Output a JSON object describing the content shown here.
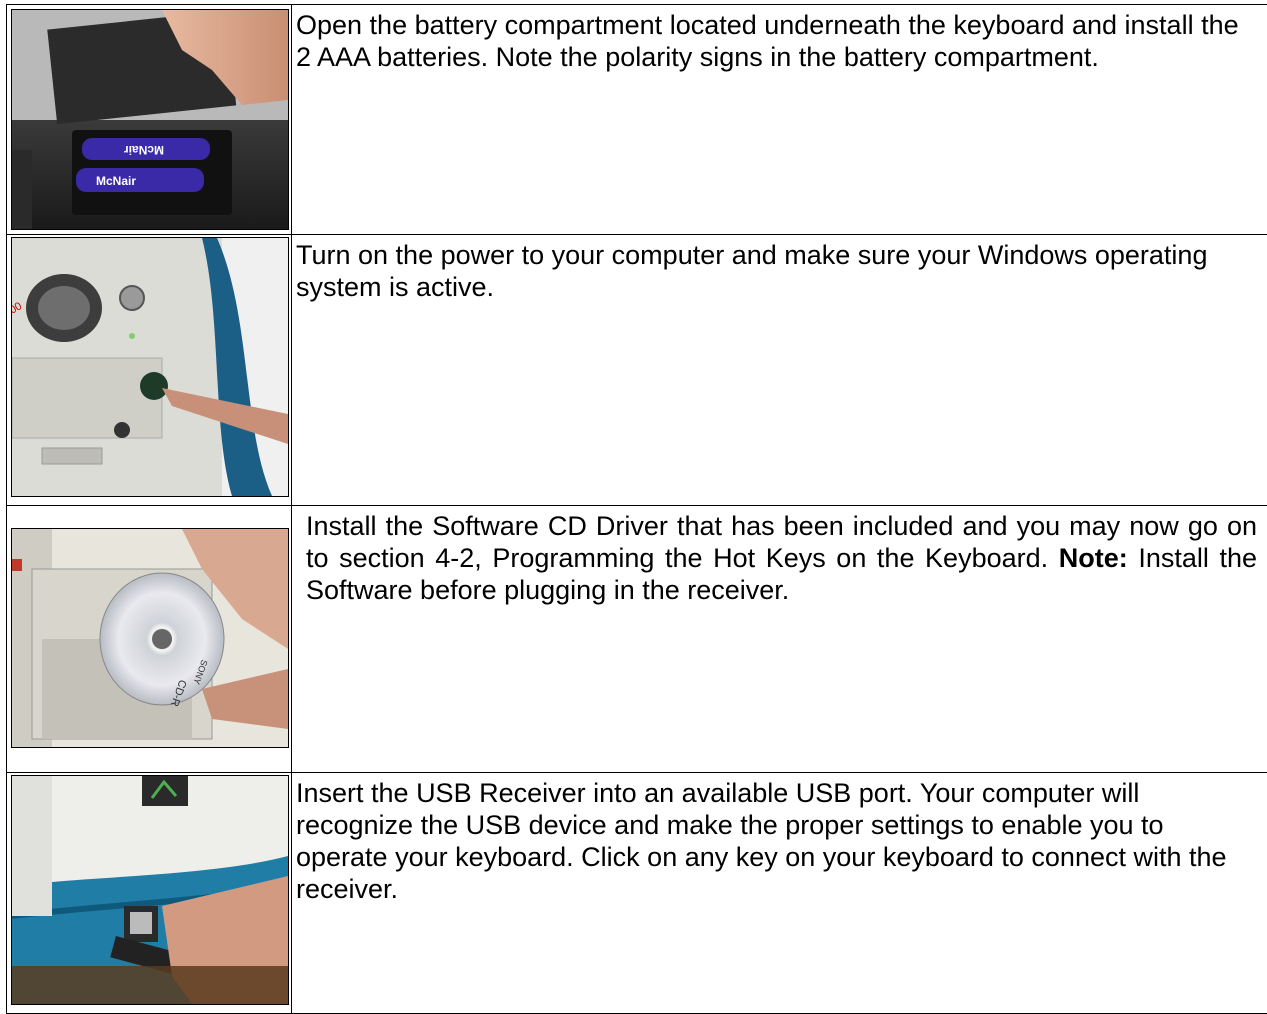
{
  "steps": [
    {
      "text": "Open the battery compartment located underneath the keyboard and install the 2 AAA batteries. Note the polarity signs in the battery compartment."
    },
    {
      "text": "Turn on the power to your computer and make sure your Windows operating system is active."
    },
    {
      "text_before": "Install the Software CD Driver that has been included and you may now go on to section 4-2, Programming the Hot Keys on the Keyboard.",
      "note_label": "Note:",
      "text_after": "Install the Software before plugging in the receiver."
    },
    {
      "text": "Insert the USB Receiver into an available USB port. Your computer will recognize the USB device and make the proper settings to enable you to operate your keyboard. Click on any key on your keyboard to connect with the receiver."
    }
  ],
  "photo_labels": {
    "battery_brand_top": "McNair",
    "battery_brand_bottom": "McNair",
    "cd_brand": "SONY",
    "cd_type": "CD-R"
  },
  "colors": {
    "border": "#000000",
    "text": "#000000",
    "background": "#ffffff"
  }
}
